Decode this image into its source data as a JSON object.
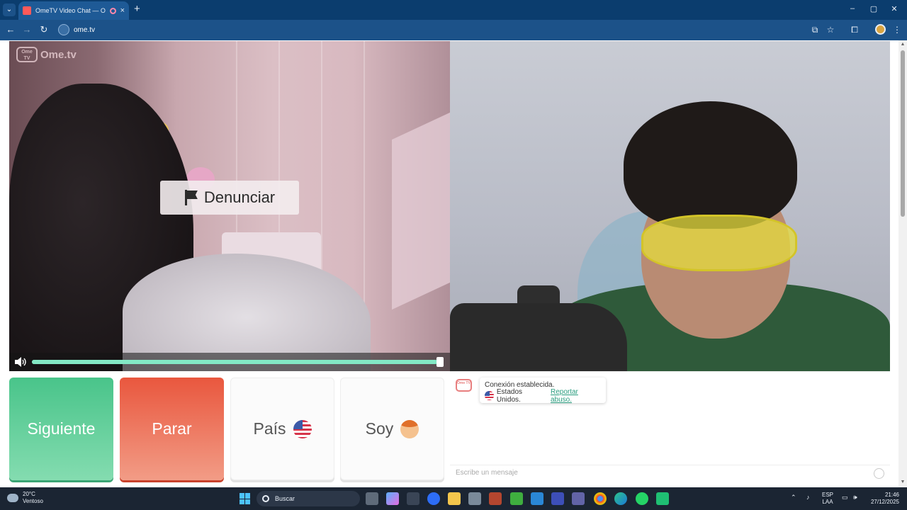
{
  "browser": {
    "tab_title": "OmeTV Video Chat — Ome",
    "tab_close": "×",
    "new_tab": "+",
    "url": "ome.tv",
    "window_controls": [
      "–",
      "▢",
      "✕"
    ]
  },
  "site": {
    "logo_badge": "Ome TV",
    "logo_text": "Ome.tv"
  },
  "video": {
    "report_label": "Denunciar",
    "volume_level": 0.985
  },
  "controls": {
    "next_label": "Siguiente",
    "stop_label": "Parar",
    "country_label": "País",
    "gender_label": "Soy"
  },
  "chat": {
    "system_logo": "Ome TV",
    "connected_text": "Conexión establecida.",
    "country_text": "Estados Unidos.",
    "report_link": "Reportar abuso.",
    "input_placeholder": "Escribe un mensaje"
  },
  "taskbar": {
    "weather_temp": "20°C",
    "weather_desc": "Ventoso",
    "search_label": "Buscar",
    "lang_top": "ESP",
    "lang_bottom": "LAA",
    "time": "21:46",
    "date": "27/12/2025"
  },
  "colors": {
    "next_button": "#49c48a",
    "stop_button": "#e9573e",
    "report_link": "#2a9d7f",
    "slider": "#83e8c5"
  },
  "icons": [
    "flag-icon",
    "speaker-icon",
    "us-flag-icon",
    "boy-emoji-icon",
    "emoji-icon",
    "search-icon",
    "windows-start-icon"
  ]
}
